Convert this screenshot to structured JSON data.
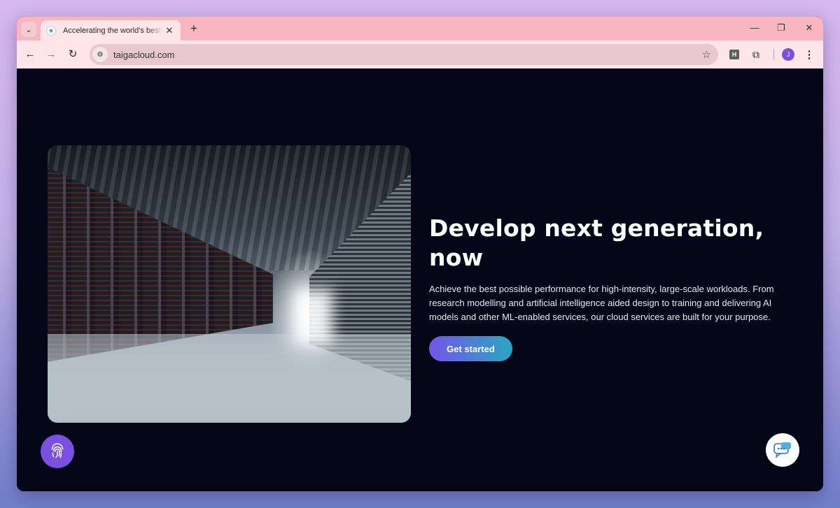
{
  "browser": {
    "tab": {
      "title": "Accelerating the world's best id"
    },
    "address": {
      "url": "taigacloud.com"
    },
    "extension_label": "H",
    "profile_initial": "J"
  },
  "hero": {
    "title": "Develop next generation, now",
    "description": "Achieve the best possible performance for high-intensity, large-scale workloads. From research modelling and artificial intelligence aided design to training and delivering AI models and other ML-enabled services, our cloud services are built for your purpose.",
    "cta_label": "Get started",
    "image_icon": "data-center-photo"
  },
  "floating": {
    "left_icon": "fingerprint-icon",
    "right_icon": "chat-icon"
  },
  "colors": {
    "page_bg": "#040617",
    "tab_strip": "#f8b6c2",
    "toolbar": "#fde5ea",
    "cta_start": "#7356e8",
    "cta_end": "#2aa6c2",
    "fingerprint_bg": "#7b4fe0",
    "avatar": "#7d4fd6"
  }
}
